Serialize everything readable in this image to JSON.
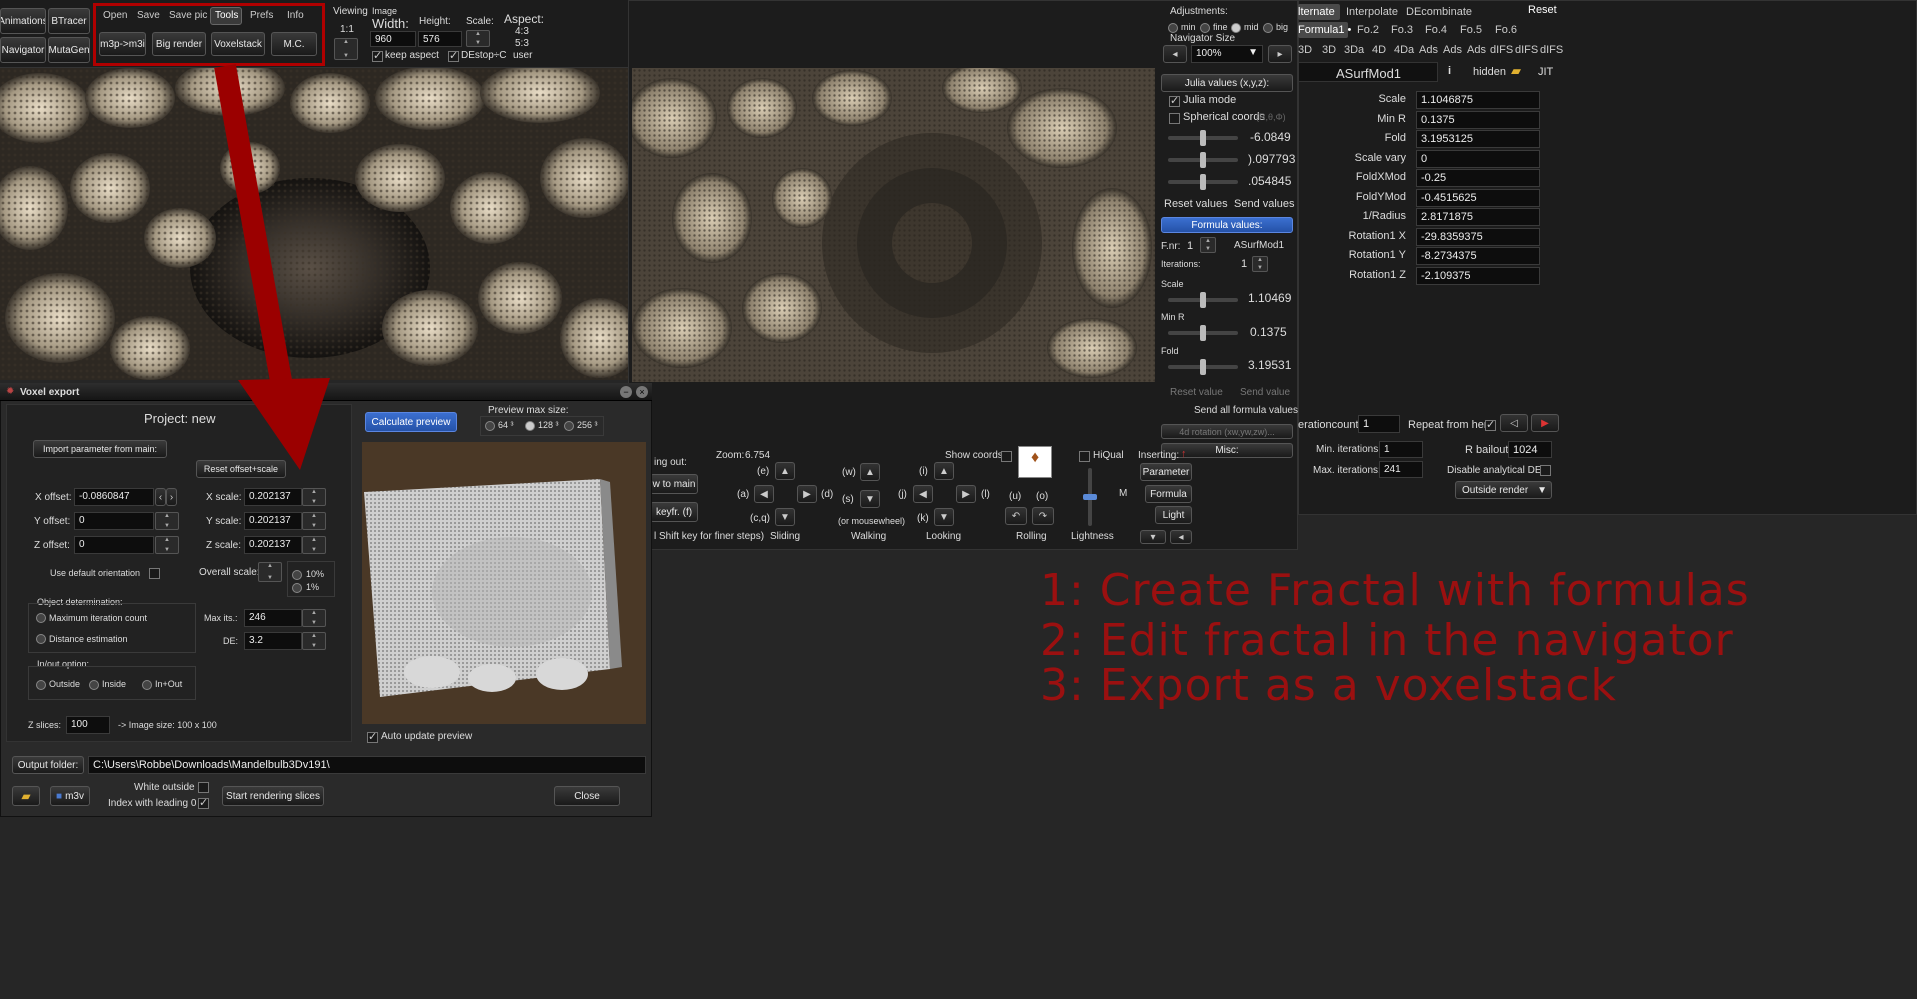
{
  "main_buttons": {
    "animations": "Animations",
    "btracer": "BTracer",
    "navigator": "Navigator",
    "mutagen": "MutaGen"
  },
  "menu_tabs": [
    "Open",
    "Save",
    "Save pic",
    "Tools",
    "Prefs",
    "Info"
  ],
  "tool_buttons": [
    "m3p->m3i",
    "Big render",
    "Voxelstack",
    "M.C."
  ],
  "viewing": {
    "label": "Viewing",
    "ratio": "1:1"
  },
  "image": {
    "label": "Image",
    "width_label": "Width:",
    "width": "960",
    "height_label": "Height:",
    "height": "576",
    "scale_label": "Scale:",
    "keep_aspect": "keep aspect",
    "destop": "DEstop÷C",
    "aspect_label": "Aspect:",
    "aspect_options": [
      "4:3",
      "5:3",
      "user"
    ]
  },
  "adjustments": {
    "title": "Adjustments:",
    "options": [
      "min",
      "fine",
      "mid",
      "big"
    ],
    "nav_size_label": "Navigator Size",
    "nav_size": "100%",
    "julia_button": "Julia values (x,y,z):",
    "julia_mode": "Julia mode",
    "spherical": "Spherical coords",
    "spherical_hint": "(R,θ,Φ)",
    "values": [
      "-6.0849",
      ").097793",
      ".054845"
    ],
    "reset_values": "Reset values",
    "send_values": "Send values",
    "formula_values": "Formula values:",
    "fnr_label": "F.nr:",
    "fnr": "1",
    "formula_name": "ASurfMod1",
    "iterations_label": "Iterations:",
    "iterations": "1",
    "params": [
      {
        "label": "Scale",
        "value": "1.10469"
      },
      {
        "label": "Min R",
        "value": "0.1375"
      },
      {
        "label": "Fold",
        "value": "3.19531"
      }
    ],
    "reset_value": "Reset value",
    "send_value": "Send value",
    "send_all": "Send all formula values",
    "rotation": "4d rotation (xw,yw,zw)...",
    "misc": "Misc:"
  },
  "navigator": {
    "going_out": "ing out:",
    "to_main": "w to main",
    "keyfr": "keyfr. (f)",
    "shift_hint": "l Shift key for finer steps)",
    "zoom_label": "Zoom:",
    "zoom": "6.754",
    "show_coords": "Show coords",
    "keys": {
      "e": "(e)",
      "a": "(a)",
      "d": "(d)",
      "cq": "(c,q)",
      "w": "(w)",
      "s": "(s)",
      "i": "(i)",
      "j": "(j)",
      "l": "(l)",
      "k": "(k)",
      "u": "(u)",
      "o": "(o)"
    },
    "mousewheel": "(or mousewheel)",
    "sliding": "Sliding",
    "walking": "Walking",
    "looking": "Looking",
    "rolling": "Rolling",
    "lightness": "Lightness",
    "hiqual": "HiQual",
    "inserting": "Inserting:",
    "ins_buttons": [
      "Parameter",
      "Formula",
      "Light"
    ],
    "m_label": "M"
  },
  "formula_panel": {
    "tabs": [
      "lternate",
      "Interpolate",
      "DEcombinate"
    ],
    "reset": "Reset",
    "slots": [
      "Formula1 •",
      "Fo.2",
      "Fo.3",
      "Fo.4",
      "Fo.5",
      "Fo.6"
    ],
    "types": [
      "3D",
      "3D",
      "3Da",
      "4D",
      "4Da",
      "Ads",
      "Ads",
      "Ads",
      "dIFS",
      "dIFS",
      "dIFS"
    ],
    "name": "ASurfMod1",
    "info": "i",
    "hidden": "hidden",
    "jit": "JIT",
    "params": [
      {
        "label": "Scale",
        "value": "1.1046875"
      },
      {
        "label": "Min R",
        "value": "0.1375"
      },
      {
        "label": "Fold",
        "value": "3.1953125"
      },
      {
        "label": "Scale vary",
        "value": "0"
      },
      {
        "label": "FoldXMod",
        "value": "-0.25"
      },
      {
        "label": "FoldYMod",
        "value": "-0.4515625"
      },
      {
        "label": "1/Radius",
        "value": "2.8171875"
      },
      {
        "label": "Rotation1 X",
        "value": "-29.8359375"
      },
      {
        "label": "Rotation1 Y",
        "value": "-8.2734375"
      },
      {
        "label": "Rotation1 Z",
        "value": "-2.109375"
      }
    ],
    "iterationcount_label": "erationcount",
    "iterationcount": "1",
    "repeat_label": "Repeat from here",
    "min_iter_label": "Min. iterations:",
    "min_iter": "1",
    "max_iter_label": "Max. iterations:",
    "max_iter": "241",
    "rbailout_label": "R bailout:",
    "rbailout": "1024",
    "disable_de": "Disable analytical DE",
    "outside_render": "Outside render"
  },
  "voxel": {
    "title": "Voxel export",
    "project": "Project: new",
    "import_btn": "Import parameter from main:",
    "reset_btn": "Reset offset+scale",
    "x_offset_label": "X offset:",
    "x_offset": "-0.0860847",
    "y_offset_label": "Y offset:",
    "y_offset": "0",
    "z_offset_label": "Z offset:",
    "z_offset": "0",
    "x_scale_label": "X scale:",
    "x_scale": "0.202137",
    "y_scale_label": "Y scale:",
    "y_scale": "0.202137",
    "z_scale_label": "Z scale:",
    "z_scale": "0.202137",
    "default_orient": "Use default orientation",
    "overall_scale": "Overall scale:",
    "overall_options": [
      "10%",
      "1%"
    ],
    "obj_det": "Object determination:",
    "max_iter_count": "Maximum iteration count",
    "distance_est": "Distance estimation",
    "max_its_label": "Max its.:",
    "max_its": "246",
    "de_label": "DE:",
    "de": "3.2",
    "inout": "In/out option:",
    "inout_options": [
      "Outside",
      "Inside",
      "In+Out"
    ],
    "zslices_label": "Z slices:",
    "zslices": "100",
    "image_size": "-> Image size:  100 x 100",
    "calc_preview": "Calculate preview",
    "preview_max": "Preview max size:",
    "preview_options": [
      "64 ³",
      "128 ³",
      "256 ³"
    ],
    "auto_update": "Auto update preview",
    "output_folder_btn": "Output folder:",
    "output_path": "C:\\Users\\Robbe\\Downloads\\Mandelbulb3Dv191\\",
    "m3v": "m3v",
    "white_outside": "White outside",
    "index_leading": "Index with leading 0",
    "start_render": "Start rendering slices",
    "close": "Close"
  },
  "notes": [
    "1: Create Fractal with formulas",
    "2: Edit fractal in the navigator",
    "3: Export as a voxelstack"
  ],
  "colors": {
    "annotation_red": "#9b1010",
    "accent_blue": "#2f63c4",
    "preview_bg": "#4a3826"
  }
}
